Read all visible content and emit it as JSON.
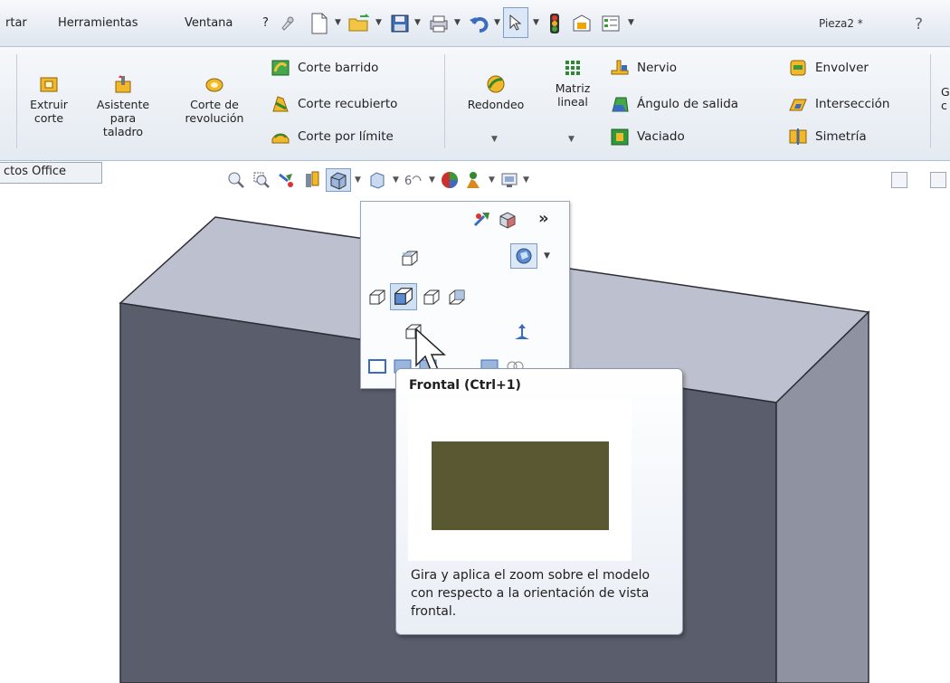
{
  "menubar": {
    "items": [
      "rtar",
      "Herramientas",
      "Ventana",
      "?"
    ],
    "document_title": "Pieza2 *"
  },
  "ribbon": {
    "extrude_cut": [
      "Extruir",
      "corte"
    ],
    "hole_wizard": [
      "Asistente",
      "para",
      "taladro"
    ],
    "revolve_cut": [
      "Corte de",
      "revolución"
    ],
    "swept_cut": "Corte barrido",
    "lofted_cut": "Corte recubierto",
    "boundary_cut": "Corte por límite",
    "fillet": "Redondeo",
    "linear_pattern": [
      "Matriz",
      "lineal"
    ],
    "rib": "Nervio",
    "draft": "Ángulo de salida",
    "shell": "Vaciado",
    "wrap": "Envolver",
    "intersect": "Intersección",
    "mirror": "Simetría",
    "cut_off": [
      "G",
      "c"
    ]
  },
  "tab": {
    "label": "ctos Office"
  },
  "tooltip": {
    "title": "Frontal  (Ctrl+1)",
    "description": "Gira y aplica el zoom sobre el modelo con respecto a la orientación de vista frontal.",
    "preview_color": "#595833"
  },
  "colors": {
    "model_front": "#5a5d6c",
    "model_top": "#bdc0ce",
    "model_side": "#8e92a1",
    "accent": "#f0a400"
  }
}
